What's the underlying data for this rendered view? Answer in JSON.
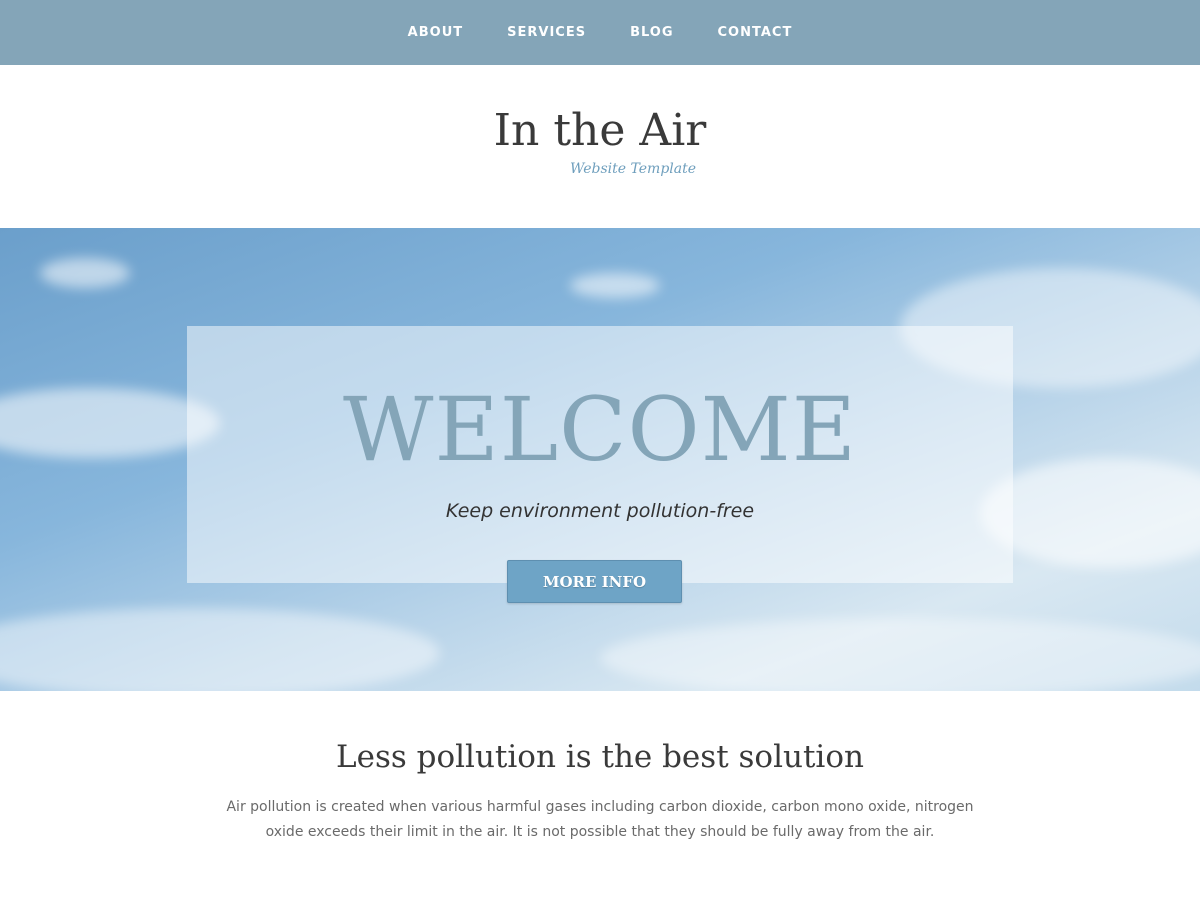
{
  "nav": {
    "items": [
      {
        "label": "ABOUT"
      },
      {
        "label": "SERVICES"
      },
      {
        "label": "BLOG"
      },
      {
        "label": "CONTACT"
      }
    ]
  },
  "header": {
    "title": "In the Air",
    "tagline": "Website Template"
  },
  "hero": {
    "title": "WELCOME",
    "subtitle": "Keep environment pollution-free",
    "button_label": "MORE INFO"
  },
  "section": {
    "heading": "Less pollution is the best solution",
    "body": "Air pollution is created when various harmful gases including carbon dioxide, carbon mono oxide, nitrogen oxide exceeds their limit in the air. It is not possible that they should be fully away from the air."
  },
  "colors": {
    "nav_background": "#84a5b8",
    "accent": "#6ea4c6",
    "tagline": "#6f9fbd",
    "text_dark": "#3a3a3a"
  }
}
